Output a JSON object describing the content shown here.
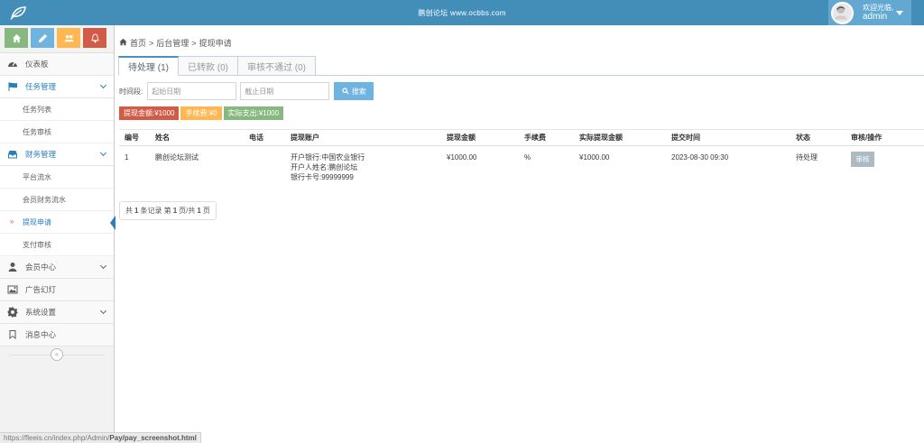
{
  "header": {
    "site_name": "鹏创论坛  www.ocbbs.com",
    "welcome": "欢迎光临,",
    "username": "admin",
    "bg_color": "#438eb9",
    "logo_icon": "leaf-icon",
    "avatar_icon": "avatar-photo"
  },
  "sidebar": {
    "shortcuts": [
      {
        "icon": "home-icon",
        "color": "#87b87f"
      },
      {
        "icon": "pencil-icon",
        "color": "#6fb3e0"
      },
      {
        "icon": "users-icon",
        "color": "#ffb752"
      },
      {
        "icon": "bell-icon",
        "color": "#d15b47"
      }
    ],
    "dashboard": "仪表板",
    "task_mgmt": "任务管理",
    "task_list": "任务列表",
    "task_audit": "任务审核",
    "finance_mgmt": "财务管理",
    "platform_flow": "平台流水",
    "member_flow": "会员财务流水",
    "withdraw_apply": "提现申请",
    "pay_audit": "支付审核",
    "member_center": "会员中心",
    "ad_slides": "广告幻灯",
    "system_settings": "系统设置",
    "message_center": "消息中心",
    "collapse_glyph": "«",
    "submenu_marker": "»"
  },
  "breadcrumb": {
    "home": "首页",
    "sep": ">",
    "admin": "后台管理",
    "current": "提现申请"
  },
  "tabs": [
    {
      "label": "待处理 (1)"
    },
    {
      "label": "已转款 (0)"
    },
    {
      "label": "审核不通过 (0)"
    }
  ],
  "filter": {
    "label": "时间段:",
    "start_placeholder": "起始日期",
    "end_placeholder": "截止日期",
    "search_label": "搜索"
  },
  "summary": [
    {
      "text": "提现金额:¥1000",
      "color": "#d15b47"
    },
    {
      "text": "手续费:¥0",
      "color": "#ffb752"
    },
    {
      "text": "实际支出:¥1000",
      "color": "#87b87f"
    }
  ],
  "table": {
    "headers": [
      "编号",
      "姓名",
      "电话",
      "提现账户",
      "提现金额",
      "手续费",
      "实际提现金额",
      "提交时间",
      "状态",
      "审核/操作"
    ],
    "rows": [
      {
        "id": "1",
        "name": "鹏创论坛测试",
        "phone": "",
        "bank": "开户银行:中国农业银行",
        "holder": "开户人姓名:鹏创论坛",
        "card": "银行卡号:99999999",
        "amount": "¥1000.00",
        "fee": "%",
        "actual": "¥1000.00",
        "time": "2023-08-30 09:30",
        "status": "待处理",
        "action": "审核"
      }
    ]
  },
  "pager": {
    "p1": "共",
    "total": "1",
    "p2": "条记录 第",
    "page": "1",
    "p3": "页/共",
    "pages": "1",
    "p4": "页"
  },
  "statusbar": {
    "url_prefix": "https://fleeis.cn/index.php/Admin/",
    "url_bold": "Pay/pay_screenshot.html"
  }
}
